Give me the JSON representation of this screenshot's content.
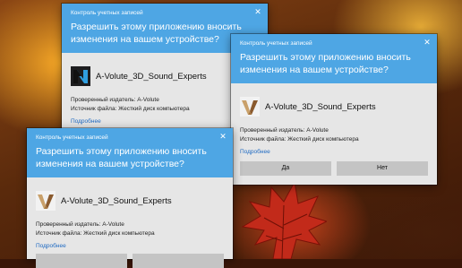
{
  "colors": {
    "header_blue": "#4ea6e4",
    "dialog_bg": "#e6e6e6",
    "link": "#1f6ac2",
    "button_bg": "#c4c4c4"
  },
  "dialogs": [
    {
      "window_title": "Контроль учетных записей",
      "question": "Разрешить этому приложению вносить изменения на вашем устройстве?",
      "app_name": "A-Volute_3D_Sound_Experts",
      "logo_icon": "nahimic-n-logo-icon",
      "publisher": "Проверенный издатель: A-Volute",
      "source": "Источник файла: Жесткий диск компьютера",
      "details_link": "Подробнее",
      "buttons": []
    },
    {
      "window_title": "Контроль учетных записей",
      "question": "Разрешить этому приложению вносить изменения на вашем устройстве?",
      "app_name": "A-Volute_3D_Sound_Experts",
      "logo_icon": "a-volute-logo-icon",
      "publisher": "Проверенный издатель: A-Volute",
      "source": "Источник файла: Жесткий диск компьютера",
      "details_link": "Подробнее",
      "buttons": [
        "Да",
        "Нет"
      ]
    },
    {
      "window_title": "Контроль учетных записей",
      "question": "Разрешить этому приложению вносить изменения на вашем устройстве?",
      "app_name": "A-Volute_3D_Sound_Experts",
      "logo_icon": "a-volute-logo-icon",
      "publisher": "Проверенный издатель: A-Volute",
      "source": "Источник файла: Жесткий диск компьютера",
      "details_link": "Подробнее",
      "buttons": [
        "",
        ""
      ]
    }
  ]
}
